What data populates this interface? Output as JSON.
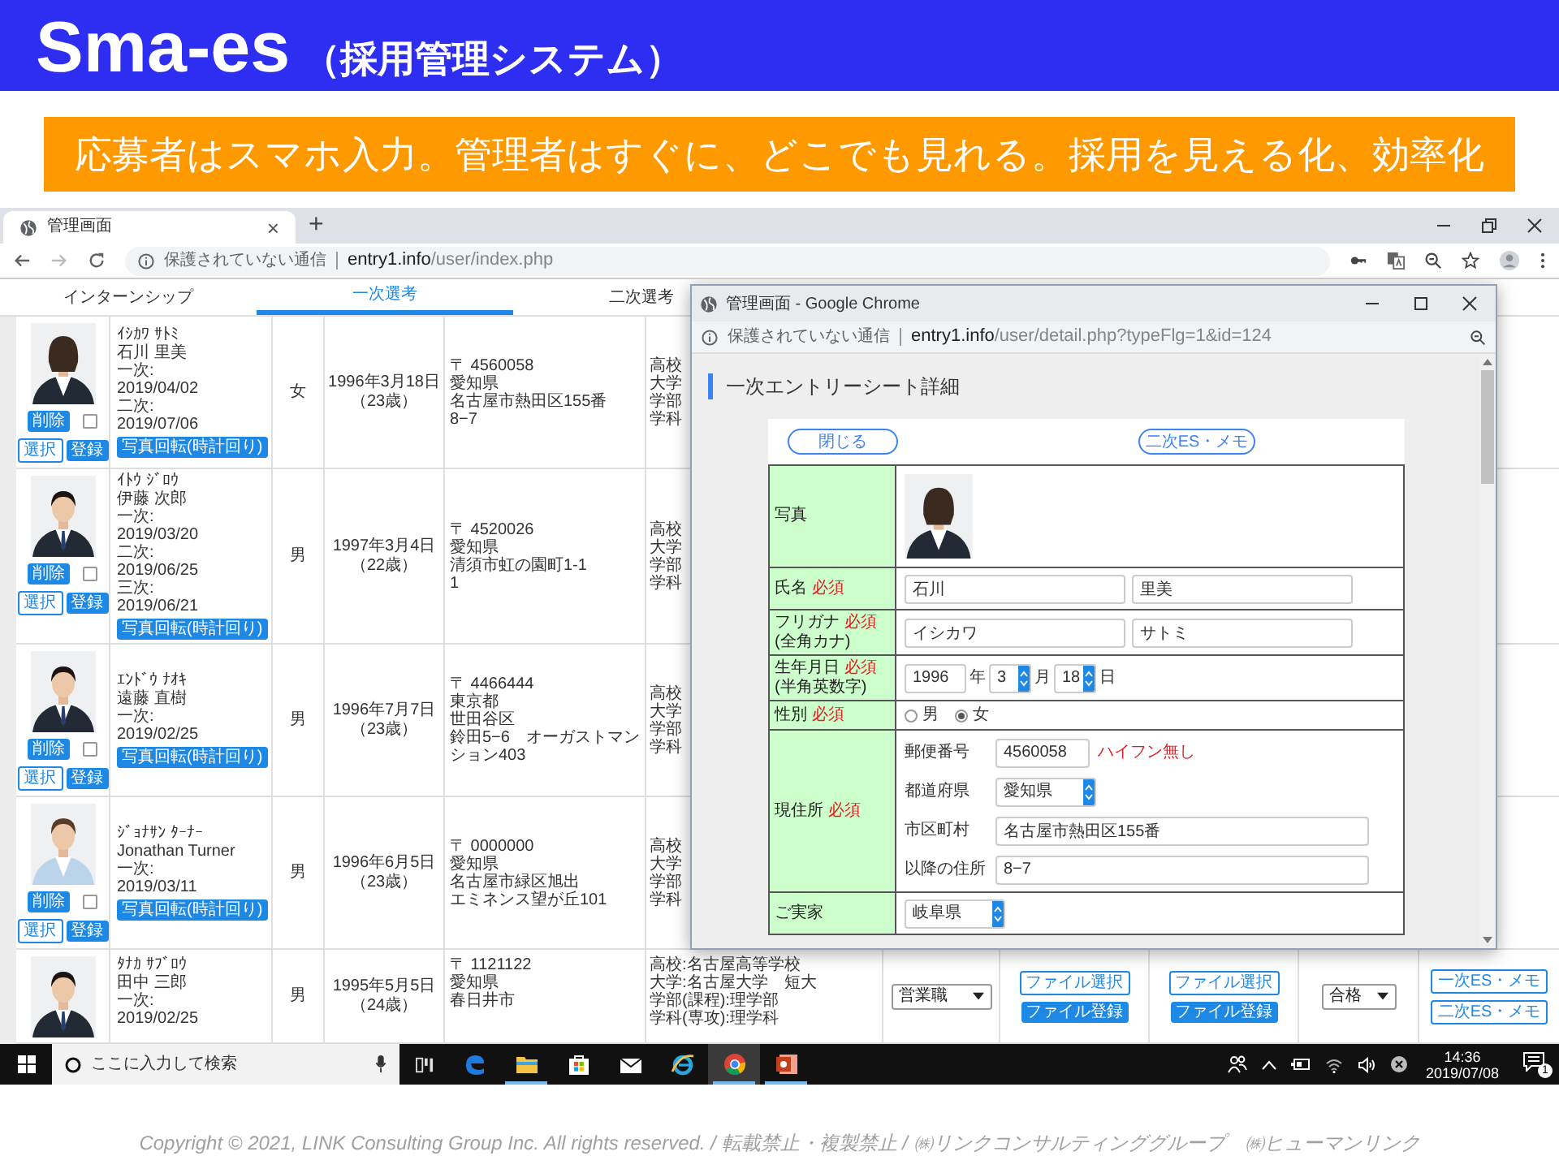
{
  "slide": {
    "title": "Sma-es",
    "subtitle": "（採用管理システム）",
    "banner": "応募者はスマホ入力。管理者はすぐに、どこでも見れる。採用を見える化、効率化",
    "copyright": "Copyright © 2021, LINK Consulting Group Inc. All rights reserved. / 転載禁止・複製禁止 / ㈱リンクコンサルティンググループ　㈱ヒューマンリンク"
  },
  "browser": {
    "tab": {
      "title": "管理画面",
      "close": "×"
    },
    "new_tab": "+",
    "address": {
      "security": "保護されていない通信",
      "host": "entry1.info",
      "path": "/user/index.php"
    }
  },
  "page_tabs": [
    {
      "label": "インターンシップ",
      "selected": false
    },
    {
      "label": "一次選考",
      "selected": true
    },
    {
      "label": "二次選考",
      "selected": false
    }
  ],
  "applicants": [
    {
      "kana": "ｲｼｶﾜ ｻﾄﾐ",
      "name": "石川 里美",
      "stages": [
        {
          "label": "一次:",
          "date": "2019/04/02"
        },
        {
          "label": "二次:",
          "date": "2019/07/06"
        }
      ],
      "gender": "女",
      "birth": "1996年3月18日",
      "age": "（23歳）",
      "address": [
        "〒 4560058",
        "愛知県",
        "名古屋市熱田区155番",
        "8−7"
      ],
      "school": [
        "高校",
        "大学",
        "学部",
        "学科"
      ],
      "actions": {
        "delete": "削除",
        "select": "選択",
        "register": "登録",
        "rotate": "写真回転(時計回り)",
        "checked": false
      }
    },
    {
      "kana": "ｲﾄｳ ｼﾞﾛｳ",
      "name": "伊藤 次郎",
      "stages": [
        {
          "label": "一次:",
          "date": "2019/03/20"
        },
        {
          "label": "二次:",
          "date": "2019/06/25"
        },
        {
          "label": "三次:",
          "date": "2019/06/21"
        }
      ],
      "gender": "男",
      "birth": "1997年3月4日",
      "age": "（22歳）",
      "address": [
        "〒 4520026",
        "愛知県",
        "清須市虹の園町1-1",
        "1"
      ],
      "school": [
        "高校",
        "大学",
        "学部",
        "学科"
      ],
      "actions": {
        "delete": "削除",
        "select": "選択",
        "register": "登録",
        "rotate": "写真回転(時計回り)",
        "checked": false
      }
    },
    {
      "kana": "ｴﾝﾄﾞｳ ﾅｵｷ",
      "name": "遠藤 直樹",
      "stages": [
        {
          "label": "一次:",
          "date": "2019/02/25"
        }
      ],
      "gender": "男",
      "birth": "1996年7月7日",
      "age": "（23歳）",
      "address": [
        "〒 4466444",
        "東京都",
        "世田谷区",
        "鈴田5−6　オーガストマンション403"
      ],
      "school": [
        "高校",
        "大学",
        "学部",
        "学科"
      ],
      "actions": {
        "delete": "削除",
        "select": "選択",
        "register": "登録",
        "rotate": "写真回転(時計回り)",
        "checked": false
      }
    },
    {
      "kana": "ｼﾞｮﾅｻﾝ ﾀｰﾅｰ",
      "name": "Jonathan Turner",
      "stages": [
        {
          "label": "一次:",
          "date": "2019/03/11"
        }
      ],
      "gender": "男",
      "birth": "1996年6月5日",
      "age": "（23歳）",
      "address": [
        "〒 0000000",
        "愛知県",
        "名古屋市緑区旭出",
        "エミネンス望が丘101"
      ],
      "school": [
        "高校",
        "大学",
        "学部",
        "学科"
      ],
      "actions": {
        "delete": "削除",
        "select": "選択",
        "register": "登録",
        "rotate": "写真回転(時計回り)",
        "checked": false
      }
    },
    {
      "kana": "ﾀﾅｶ ｻﾌﾞﾛｳ",
      "name": "田中 三郎",
      "stages": [
        {
          "label": "一次:",
          "date": "2019/02/25"
        }
      ],
      "gender": "男",
      "birth": "1995年5月5日",
      "age": "（24歳）",
      "address": [
        "〒 1121122",
        "愛知県",
        "春日井市"
      ],
      "school": [
        "高校:名古屋高等学校",
        "大学:名古屋大学　短大",
        "学部(課程):理学部",
        "学科(専攻):理学科"
      ],
      "job": "営業職",
      "files": [
        {
          "choose": "ファイル選択",
          "upload": "ファイル登録"
        },
        {
          "choose": "ファイル選択",
          "upload": "ファイル登録"
        }
      ],
      "result": "合格",
      "memos": [
        "一次ES・メモ",
        "二次ES・メモ"
      ]
    }
  ],
  "popup": {
    "title": "管理画面 - Google Chrome",
    "address": {
      "security": "保護されていない通信",
      "host": "entry1.info",
      "path": "/user/detail.php?typeFlg=1&id=124"
    },
    "heading": "一次エントリーシート詳細",
    "buttons": [
      "閉じる",
      "二次ES・メモ"
    ],
    "form": [
      {
        "label": "写真"
      },
      {
        "kind": "pair",
        "label": "氏名",
        "required": "必須",
        "values": [
          "石川",
          "里美"
        ]
      },
      {
        "kind": "pair",
        "label": "フリガナ",
        "required": "必須",
        "note": "(全角カナ)",
        "values": [
          "イシカワ",
          "サトミ"
        ]
      },
      {
        "kind": "date",
        "label": "生年月日",
        "required": "必須",
        "note": "(半角英数字)",
        "year": "1996",
        "year_unit": "年",
        "month": "3",
        "month_unit": "月",
        "day": "18",
        "day_unit": "日"
      },
      {
        "kind": "radio",
        "label": "性別",
        "required": "必須",
        "options": [
          {
            "label": "男",
            "selected": false
          },
          {
            "label": "女",
            "selected": true
          }
        ]
      },
      {
        "kind": "address",
        "label": "現住所",
        "required": "必須",
        "fields": [
          {
            "kind": "input",
            "label": "郵便番号",
            "value": "4560058",
            "hint": "ハイフン無し"
          },
          {
            "kind": "select",
            "label": "都道府県",
            "value": "愛知県"
          },
          {
            "kind": "input",
            "label": "市区町村",
            "value": "名古屋市熱田区155番"
          },
          {
            "kind": "input",
            "label": "以降の住所",
            "value": "8−7"
          }
        ]
      },
      {
        "kind": "select",
        "label": "ご実家",
        "value": "岐阜県"
      }
    ]
  },
  "taskbar": {
    "search_placeholder": "ここに入力して検索",
    "apps": [
      {
        "kind": "edge",
        "running": false,
        "active": false
      },
      {
        "kind": "explorer",
        "running": true,
        "active": false
      },
      {
        "kind": "store",
        "running": false,
        "active": false
      },
      {
        "kind": "mail",
        "running": false,
        "active": false
      },
      {
        "kind": "ie",
        "running": false,
        "active": false
      },
      {
        "kind": "chrome",
        "running": true,
        "active": true
      },
      {
        "kind": "powerpoint",
        "running": true,
        "active": false
      }
    ],
    "time": "14:36",
    "date": "2019/07/08",
    "notifications": "1"
  }
}
